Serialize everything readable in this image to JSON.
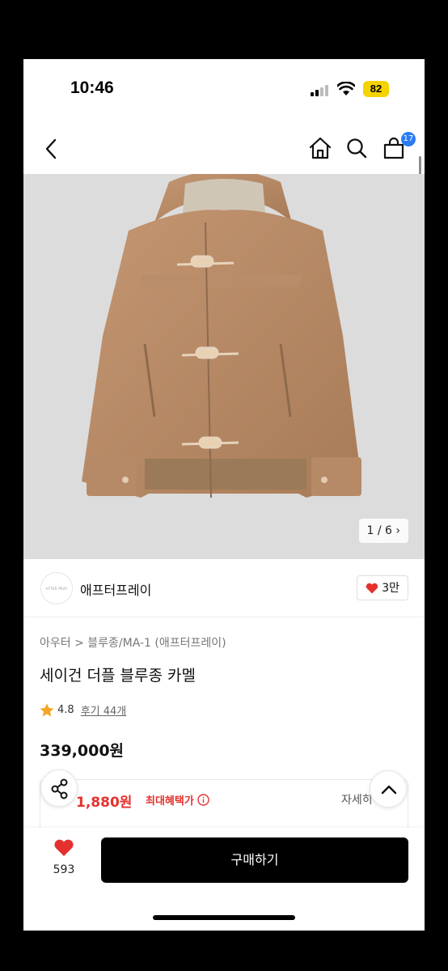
{
  "status_bar": {
    "time": "10:46",
    "battery": "82"
  },
  "nav": {
    "cart_count": "17"
  },
  "gallery": {
    "page_indicator": "1 / 6"
  },
  "brand": {
    "logo_text": "AFTER PRAY",
    "name": "애프터프레이",
    "likes": "3만"
  },
  "product": {
    "breadcrumb": "아우터 > 블루종/MA-1 (애프터프레이)",
    "title": "세이건 더플 블루종 카멜",
    "rating": "4.8",
    "reviews": "후기 44개",
    "price": "339,000원"
  },
  "benefit": {
    "price": "1,880원",
    "label": "최대혜택가",
    "detail": "자세히"
  },
  "bottom": {
    "wish_count": "593",
    "buy_label": "구매하기"
  },
  "colors": {
    "accent_red": "#e5312e",
    "badge_blue": "#2b7cf3",
    "star": "#f5a623",
    "coat": "#b88a65"
  }
}
